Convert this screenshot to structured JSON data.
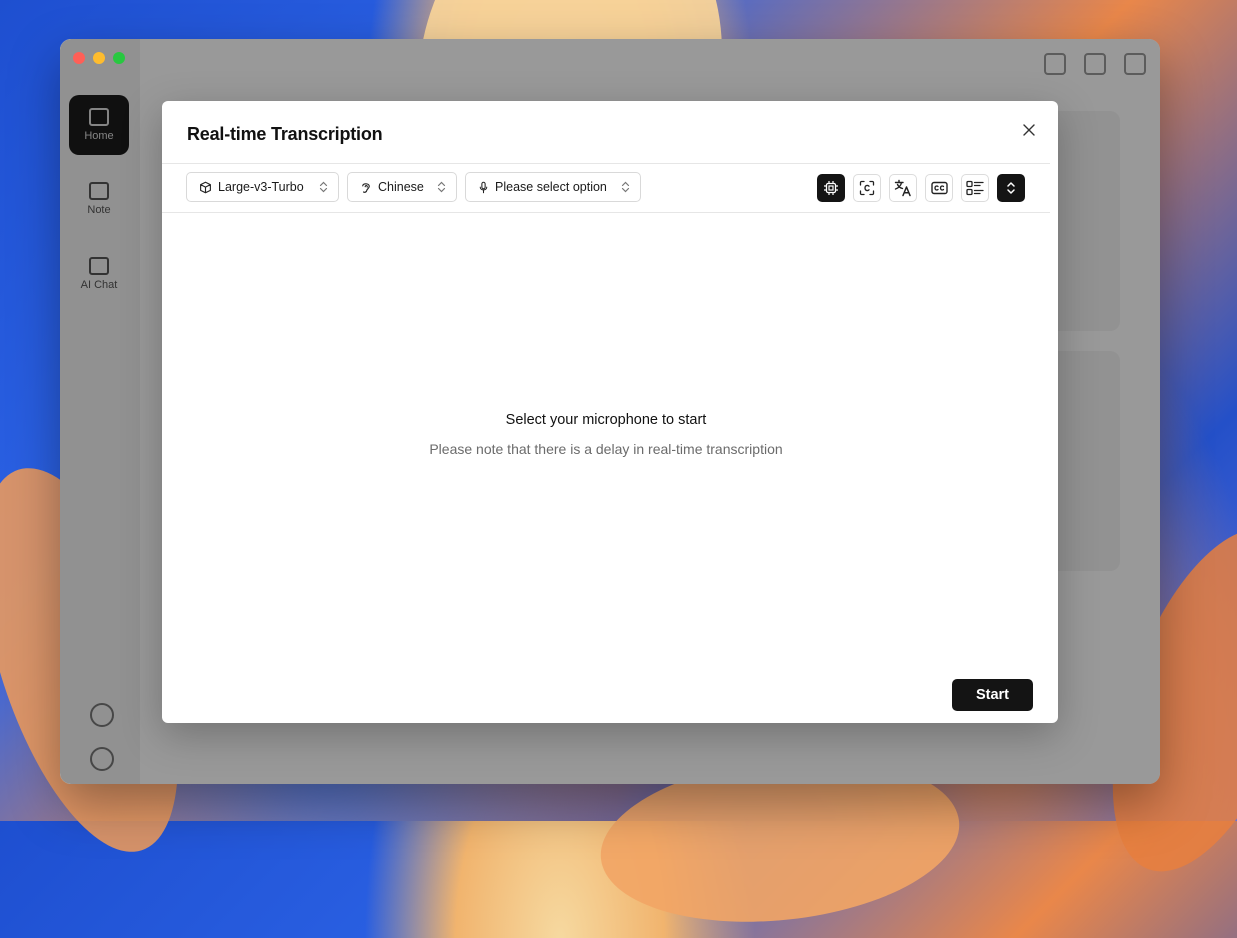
{
  "app": {
    "sidebar": {
      "items": [
        {
          "label": "Home",
          "icon": "home-icon"
        },
        {
          "label": "Note",
          "icon": "note-icon"
        },
        {
          "label": "AI Chat",
          "icon": "chat-icon"
        }
      ]
    }
  },
  "modal": {
    "title": "Real-time Transcription",
    "toolbar": {
      "model_select": {
        "value": "Large-v3-Turbo",
        "icon": "cube-icon"
      },
      "language_select": {
        "value": "Chinese",
        "icon": "ear-icon"
      },
      "microphone_select": {
        "placeholder": "Please select option",
        "icon": "microphone-icon"
      },
      "buttons": [
        {
          "name": "cpu-icon",
          "active": true
        },
        {
          "name": "scan-icon",
          "active": false
        },
        {
          "name": "translate-icon",
          "active": false
        },
        {
          "name": "captions-icon",
          "active": false
        },
        {
          "name": "list-layout-icon",
          "active": false
        },
        {
          "name": "chevron-up-down-icon",
          "active": true
        }
      ]
    },
    "empty_state": {
      "title": "Select your microphone to start",
      "subtitle": "Please note that there is a delay in real-time transcription"
    },
    "start_label": "Start"
  },
  "colors": {
    "primary": "#141414",
    "border": "#d9d9d9",
    "muted_text": "#6b6b6b"
  }
}
